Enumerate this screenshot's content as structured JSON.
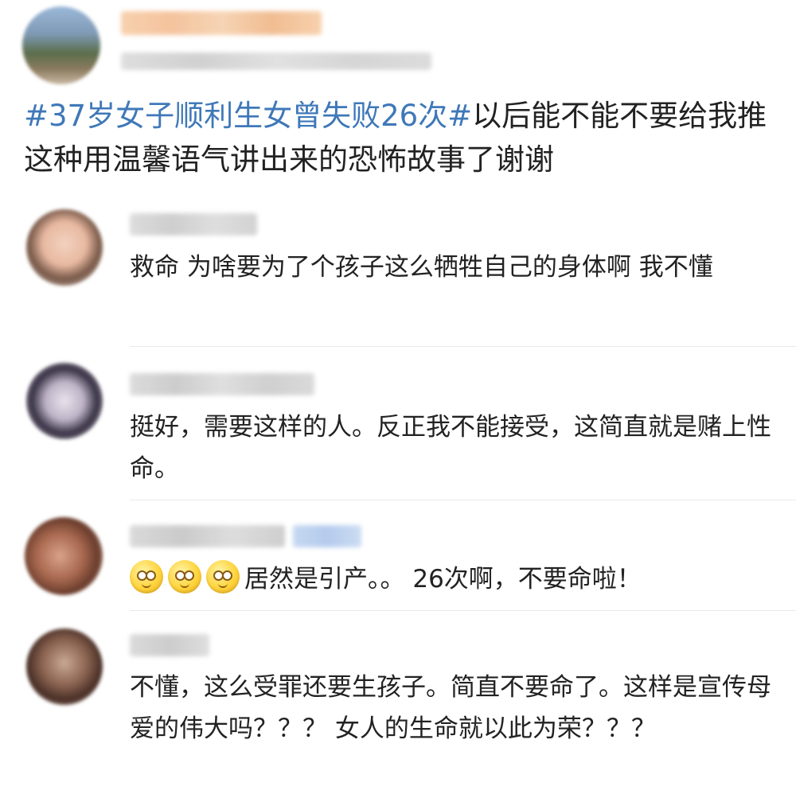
{
  "post": {
    "hashtag": "#37岁女子顺利生女曾失败26次#",
    "text": "以后能不能不要给我推这种用温馨语气讲出来的恐怖故事了谢谢"
  },
  "comments": [
    {
      "text": "救命 为啥要为了个孩子这么牺牲自己的身体啊 我不懂"
    },
    {
      "text": "挺好，需要这样的人。反正我不能接受，这简直就是赌上性命。"
    },
    {
      "emojis": [
        "smile-emoji",
        "smile-emoji",
        "smile-emoji"
      ],
      "text": "居然是引产。。 26次啊，不要命啦！"
    },
    {
      "text": "不懂，这么受罪还要生孩子。简直不要命了。这样是宣传母爱的伟大吗？？？ 女人的生命就以此为荣？？？"
    }
  ],
  "colors": {
    "hashtag": "#3f78b8",
    "text": "#222222",
    "divider": "#e9e9e9"
  }
}
